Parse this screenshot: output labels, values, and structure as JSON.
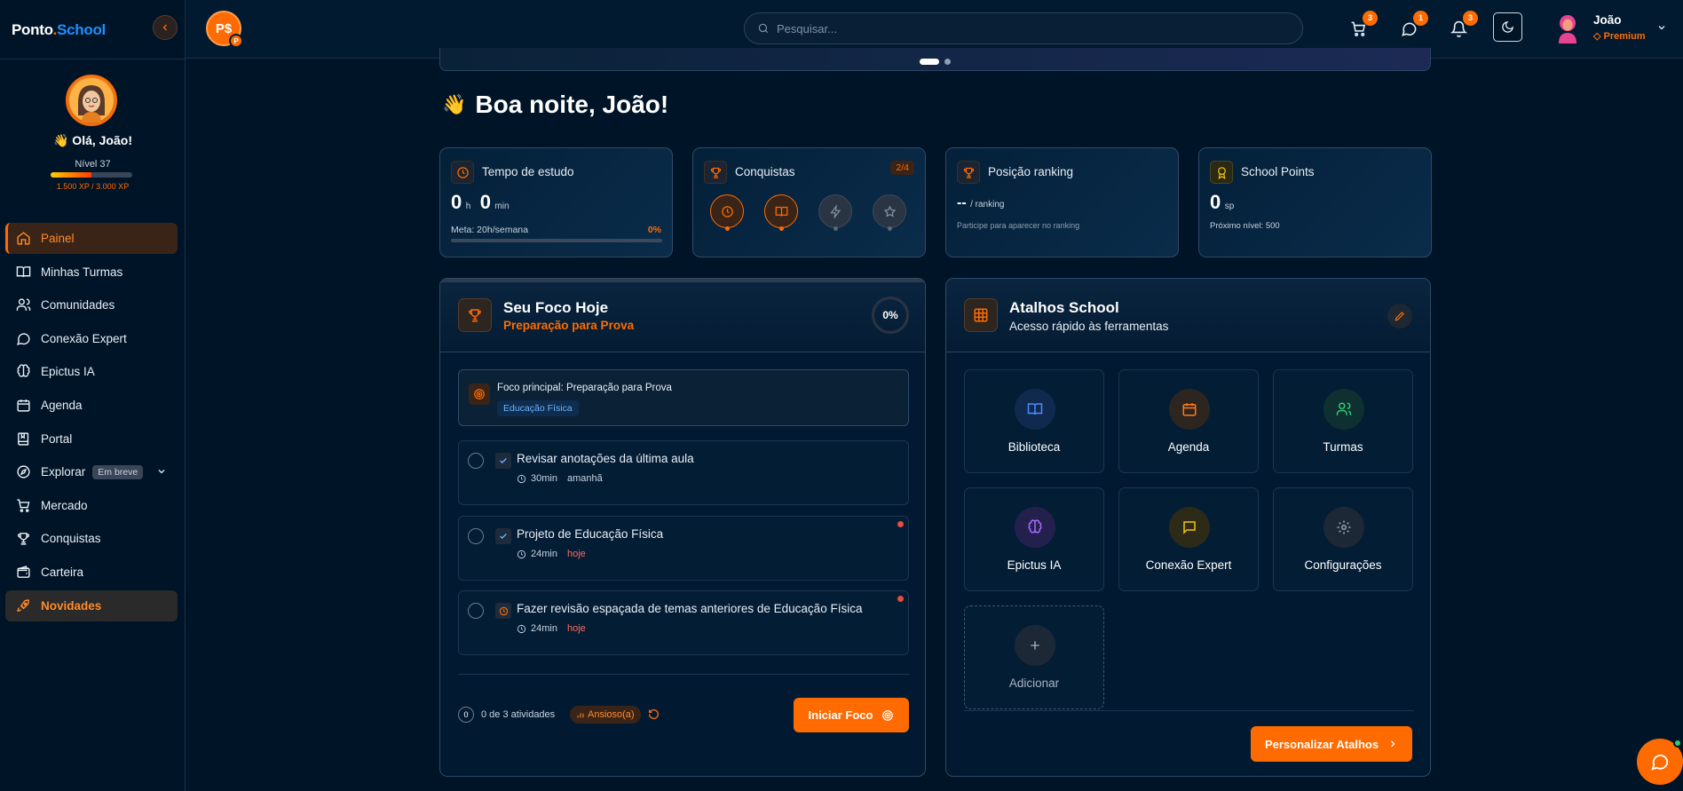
{
  "brand": {
    "part1": "Ponto",
    "dot": ".",
    "part2": "School"
  },
  "profile": {
    "greeting": "👋 Olá, João!",
    "level": "Nível 37",
    "xp_text": "1.500 XP / 3.000 XP",
    "xp_progress": 0.5
  },
  "sidebar": {
    "items": [
      {
        "label": "Painel",
        "icon": "home-icon"
      },
      {
        "label": "Minhas Turmas",
        "icon": "book-icon"
      },
      {
        "label": "Comunidades",
        "icon": "users-icon"
      },
      {
        "label": "Conexão Expert",
        "icon": "message-circle-icon"
      },
      {
        "label": "Epictus IA",
        "icon": "brain-icon"
      },
      {
        "label": "Agenda",
        "icon": "calendar-icon"
      },
      {
        "label": "Portal",
        "icon": "book-bookmark-icon"
      },
      {
        "label": "Explorar",
        "icon": "compass-icon",
        "badge": "Em breve"
      },
      {
        "label": "Mercado",
        "icon": "cart-icon"
      },
      {
        "label": "Conquistas",
        "icon": "trophy-icon"
      },
      {
        "label": "Carteira",
        "icon": "wallet-icon"
      },
      {
        "label": "Novidades",
        "icon": "rocket-icon"
      }
    ]
  },
  "topbar": {
    "avatar_initials": "P$",
    "avatar_badge": "P",
    "search_placeholder": "Pesquisar...",
    "cart_count": "3",
    "messages_count": "1",
    "notifications_count": "3",
    "user_name": "João",
    "user_plan": "◇ Premium"
  },
  "main": {
    "greeting_wave": "👋",
    "greeting": "Boa noite, João!",
    "stats": {
      "study": {
        "title": "Tempo de estudo",
        "hours": "0",
        "hours_unit": "h",
        "minutes": "0",
        "minutes_unit": "min",
        "goal": "Meta: 20h/semana",
        "goal_pct": "0%"
      },
      "achievements": {
        "title": "Conquistas",
        "count": "2/4"
      },
      "ranking": {
        "title": "Posição ranking",
        "value": "--",
        "unit": "/ ranking",
        "note": "Participe para aparecer no ranking"
      },
      "points": {
        "title": "School Points",
        "value": "0",
        "unit": "sp",
        "next": "Próximo nível: 500"
      }
    },
    "focus": {
      "title": "Seu Foco Hoje",
      "subtitle": "Preparação para Prova",
      "progress": "0%",
      "main_label": "Foco principal: Preparação para Prova",
      "main_tag": "Educação Física",
      "tasks": [
        {
          "title": "Revisar anotações da última aula",
          "duration": "30min",
          "when": "amanhã"
        },
        {
          "title": "Projeto de Educação Física",
          "duration": "24min",
          "when": "hoje"
        },
        {
          "title": "Fazer revisão espaçada de temas anteriores de Educação Física",
          "duration": "24min",
          "when": "hoje"
        }
      ],
      "done_count": "0",
      "activities": "0 de 3 atividades",
      "mood": "Ansioso(a)",
      "start_button": "Iniciar Foco"
    },
    "shortcuts": {
      "title": "Atalhos School",
      "subtitle": "Acesso rápido às ferramentas",
      "tiles": [
        {
          "label": "Biblioteca",
          "icon": "book-open-icon",
          "color": "#4a8cff"
        },
        {
          "label": "Agenda",
          "icon": "calendar-icon",
          "color": "#ff7a1a"
        },
        {
          "label": "Turmas",
          "icon": "users-icon",
          "color": "#2ecc71"
        },
        {
          "label": "Epictus IA",
          "icon": "brain-icon",
          "color": "#a86bff"
        },
        {
          "label": "Conexão Expert",
          "icon": "message-square-icon",
          "color": "#f1c40f"
        },
        {
          "label": "Configurações",
          "icon": "gear-icon",
          "color": "#9aa5b1"
        }
      ],
      "add_label": "Adicionar",
      "customize_button": "Personalizar Atalhos"
    }
  },
  "colors": {
    "accent": "#FF6B00",
    "background": "#001427",
    "brand_blue": "#1f8fff"
  }
}
